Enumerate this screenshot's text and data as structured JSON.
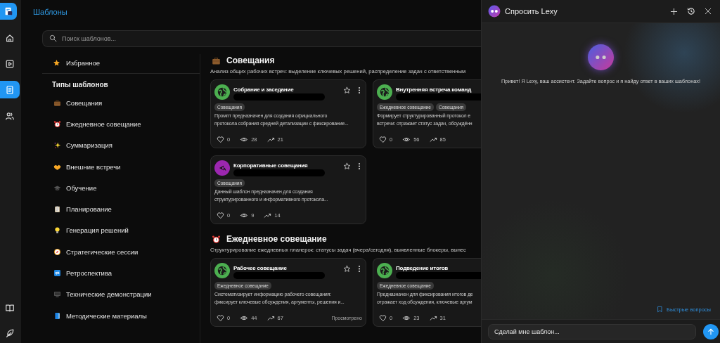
{
  "rail": {
    "top_items": [
      {
        "selected": false
      },
      {
        "selected": false
      },
      {
        "selected": true
      },
      {
        "selected": false
      }
    ],
    "bottom_items": [
      {
        "selected": false
      },
      {
        "selected": false
      }
    ]
  },
  "main": {
    "title": "Шаблоны",
    "search": {
      "placeholder": "Поиск шаблонов..."
    },
    "sidebar": {
      "favorites": {
        "label": "Избранное"
      },
      "heading": "Типы шаблонов",
      "items": [
        {
          "label": "Совещания"
        },
        {
          "label": "Ежедневное совещание"
        },
        {
          "label": "Суммаризация"
        },
        {
          "label": "Внешние встречи"
        },
        {
          "label": "Обучение"
        },
        {
          "label": "Планирование"
        },
        {
          "label": "Генерация решений"
        },
        {
          "label": "Стратегические сессии"
        },
        {
          "label": "Ретроспектива"
        },
        {
          "label": "Технические демонстрации"
        },
        {
          "label": "Методические материалы"
        }
      ]
    },
    "sections": [
      {
        "title": "Совещания",
        "description": "Анализ общих рабочих встреч: выделение ключевых решений, распределение задач с ответственным",
        "cards": [
          {
            "title": "Собрание и заседание",
            "kind": "globe",
            "color": "#4caf50",
            "tags": [
              "Совещания"
            ],
            "description_lines": [
              "Промпт предназначен для создания официального",
              "протокола собрания средней детализации с фиксирование..."
            ],
            "likes": "0",
            "views": "28",
            "uses": "21"
          },
          {
            "title": "Внутренняя встреча команд",
            "kind": "globe",
            "color": "#4caf50",
            "tags": [
              "Ежедневное совещание",
              "Совещания"
            ],
            "description_lines": [
              "Формирует структурированный протокол е",
              "встречи: отражает статус задач, обсуждённ"
            ],
            "likes": "0",
            "views": "56",
            "uses": "85"
          },
          {
            "title": "Корпоративные совещания",
            "kind": "reply",
            "color": "#9c27b0",
            "tags": [
              "Совещания"
            ],
            "description_lines": [
              "Данный шаблон предназначен для создания",
              "структурированного и информативного протокола..."
            ],
            "likes": "0",
            "views": "9",
            "uses": "14"
          }
        ]
      },
      {
        "title": "Ежедневное совещание",
        "description": "Структурирование ежедневных планерок: статусы задач (вчера/сегодня), выявленные блокеры, вынес",
        "cards": [
          {
            "title": "Рабочее совещание",
            "kind": "globe",
            "color": "#4caf50",
            "tags": [
              "Ежедневное совещание"
            ],
            "description_lines": [
              "Систематизирует информацию рабочего совещания:",
              "фиксирует ключевые обсуждения, аргументы, решения и..."
            ],
            "likes": "0",
            "views": "44",
            "uses": "67",
            "status": "Просмотрено"
          },
          {
            "title": "Подведение итогов",
            "kind": "globe",
            "color": "#4caf50",
            "tags": [
              "Ежедневное совещание"
            ],
            "description_lines": [
              "Предназначен для фиксирования итогов де",
              "отражает ход обсуждения, ключевые аргум"
            ],
            "likes": "0",
            "views": "23",
            "uses": "31"
          }
        ]
      }
    ]
  },
  "chat": {
    "title": "Спросить Lexy",
    "greeting": "Привет! Я Lexy, ваш ассистент. Задайте вопрос и я найду ответ в ваших шаблонах!",
    "quick_questions": "Быстрые вопросы",
    "input": {
      "placeholder": "Сделай мне шаблон..."
    }
  }
}
